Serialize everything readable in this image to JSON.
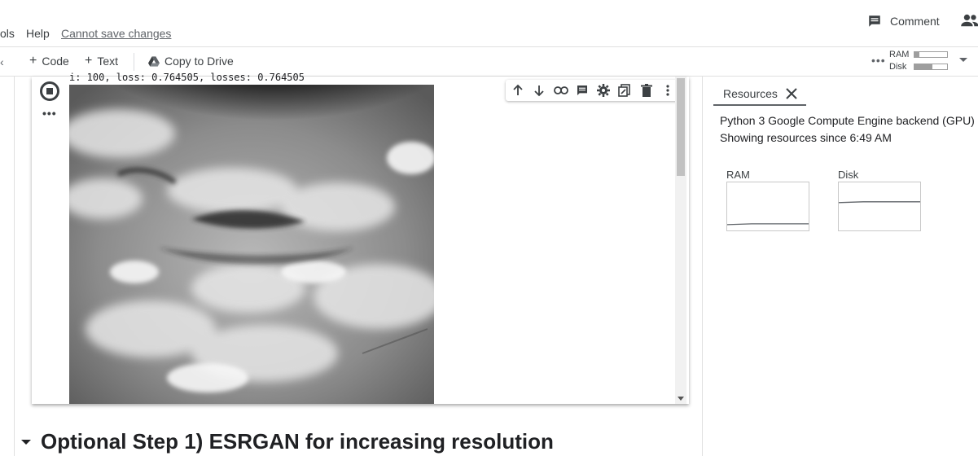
{
  "menu": {
    "tools_label": "ols",
    "help_label": "Help",
    "save_status": "Cannot save changes"
  },
  "header": {
    "comment_label": "Comment",
    "share_icon": "people-icon"
  },
  "toolbar": {
    "code_label": "Code",
    "text_label": "Text",
    "drive_label": "Copy to Drive",
    "ram_label": "RAM",
    "disk_label": "Disk",
    "ram_usage": 0.15,
    "disk_usage": 0.55
  },
  "cell": {
    "output_text": "i: 100, loss: 0.764505, losses: 0.764505",
    "toolbar_icons": [
      "arrow-up-icon",
      "arrow-down-icon",
      "link-icon",
      "comment-icon",
      "gear-icon",
      "mirror-cell-icon",
      "delete-icon",
      "more-vert-icon"
    ]
  },
  "section": {
    "title": "Optional Step 1) ESRGAN for increasing resolution"
  },
  "resources": {
    "tab_label": "Resources",
    "backend_text": "Python 3 Google Compute Engine backend (GPU)",
    "since_text": "Showing resources since 6:49 AM",
    "ram_chart_label": "RAM",
    "disk_chart_label": "Disk",
    "ram_level": 0.12,
    "disk_level": 0.58
  }
}
